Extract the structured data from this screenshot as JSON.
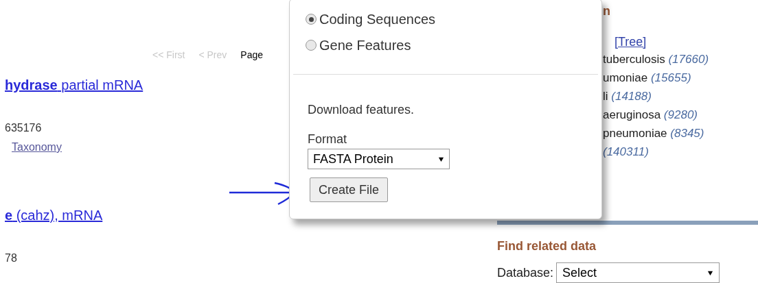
{
  "pager": [
    {
      "label": "<< First",
      "disabled": true
    },
    {
      "label": "< Prev",
      "disabled": true
    },
    {
      "label": "Page",
      "disabled": false
    }
  ],
  "results": [
    {
      "title": "**hydrase** partial mRNA",
      "detail": "635176",
      "links": [
        "Taxonomy"
      ]
    },
    {
      "title": "**e** (cahz), mRNA",
      "detail": "78"
    }
  ],
  "taxonomy": {
    "heading": "n",
    "tree_link": "[Tree]",
    "items": [
      {
        "name": "tuberculosis",
        "count": "(17660)"
      },
      {
        "name": "umoniae",
        "count": "(15655)"
      },
      {
        "name": "li",
        "count": "(14188)"
      },
      {
        "name": "aeruginosa",
        "count": "(9280)"
      },
      {
        "name": "pneumoniae",
        "count": "(8345)"
      },
      {
        "count": "(140311)"
      }
    ]
  },
  "find_related": {
    "heading": "Find related data",
    "label": "Database:",
    "value": "Select"
  },
  "popup": {
    "options": [
      {
        "label": "Coding Sequences",
        "selected": true
      },
      {
        "label": "Gene Features",
        "selected": false
      }
    ],
    "description": "Download features.",
    "format_label": "Format",
    "format_value": "FASTA Protein",
    "button": "Create File"
  }
}
